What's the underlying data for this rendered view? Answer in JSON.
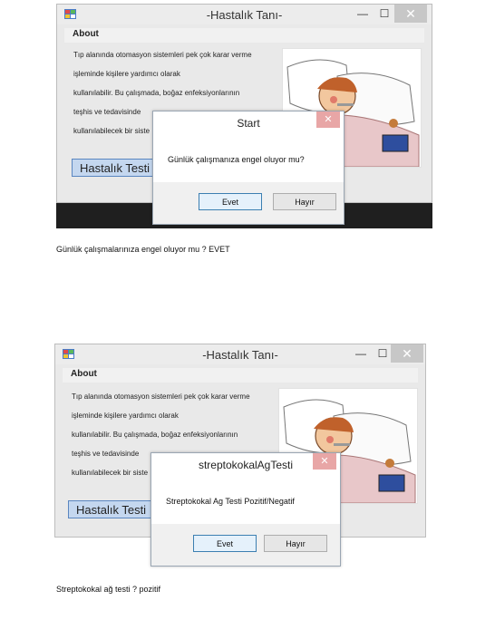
{
  "app": {
    "title": "-Hastalık Tanı-",
    "min_glyph": "—",
    "max_glyph": "☐",
    "close_glyph": "✕",
    "menu_about": "About",
    "description_lines": [
      "Tıp alanında otomasyon sistemleri pek çok karar verme",
      "işleminde kişilere yardımcı olarak",
      "kullanılabilir. Bu çalışmada, boğaz enfeksiyonlarının",
      "teşhis ve tedavisinde",
      "kullanılabilecek bir siste"
    ],
    "main_button_label": "Hastalık Testi"
  },
  "screens": [
    {
      "dialog": {
        "title": "Start",
        "message": "Günlük çalışmanıza engel oluyor mu?",
        "yes_label": "Evet",
        "no_label": "Hayır",
        "close_glyph": "✕"
      },
      "caption": "Günlük çalışmalarınıza engel oluyor mu ? EVET"
    },
    {
      "dialog": {
        "title": "streptokokalAgTesti",
        "message": "Streptokokal Ag Testi Pozitif/Negatif",
        "yes_label": "Evet",
        "no_label": "Hayır",
        "close_glyph": "✕"
      },
      "caption": "Streptokokal ağ testi ? pozitif"
    }
  ]
}
